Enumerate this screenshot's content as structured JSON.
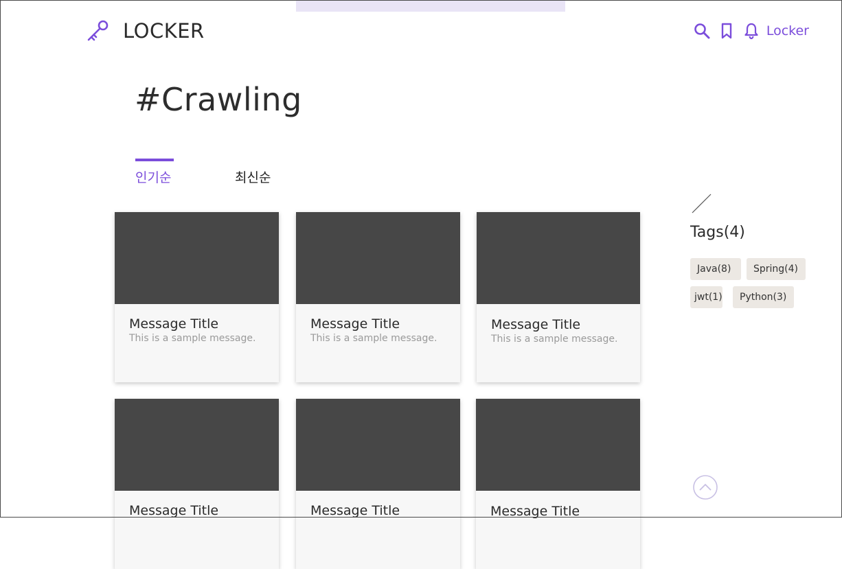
{
  "brand": {
    "name": "LOCKER",
    "icon": "key-icon"
  },
  "header": {
    "icons": [
      "search-icon",
      "bookmark-icon",
      "bell-icon"
    ],
    "user_label": "Locker"
  },
  "page": {
    "title": "#Crawling"
  },
  "tabs": [
    {
      "label": "인기순",
      "active": true
    },
    {
      "label": "최신순",
      "active": false
    }
  ],
  "cards": [
    {
      "title": "Message Title",
      "text": "This is a sample message."
    },
    {
      "title": "Message Title",
      "text": "This is a sample message."
    },
    {
      "title": "Message Title",
      "text": "This is a sample message."
    },
    {
      "title": "Message Title",
      "text": ""
    },
    {
      "title": "Message Title",
      "text": ""
    },
    {
      "title": "Message Title",
      "text": ""
    }
  ],
  "sidebar": {
    "tags_heading": "Tags(4)",
    "tags": [
      "Java(8)",
      "Spring(4)",
      "jwt(1)",
      "Python(3)"
    ]
  },
  "colors": {
    "accent": "#7b4ddb",
    "thumbnail": "#474747",
    "tag_bg": "#ece8e3"
  }
}
